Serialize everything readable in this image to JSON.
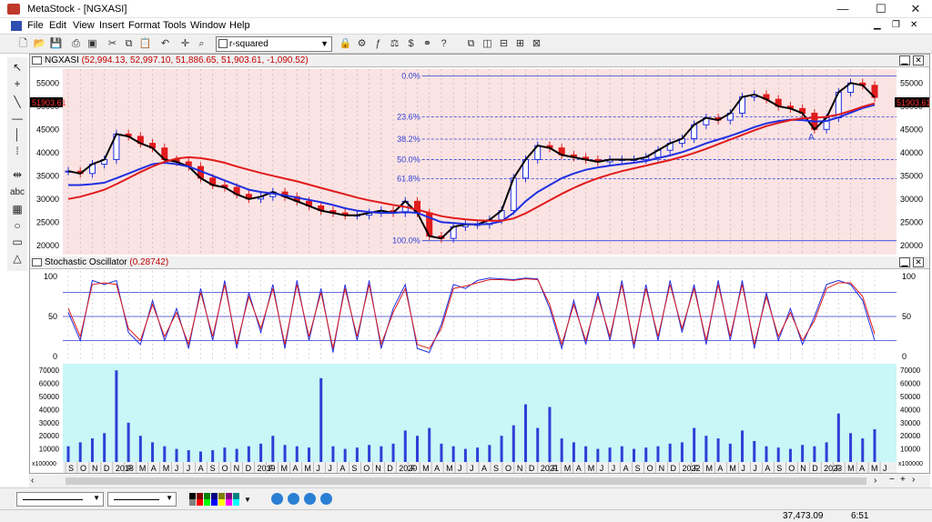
{
  "window": {
    "title": "MetaStock - [NGXASI]",
    "minimize": "—",
    "maximize": "☐",
    "close": "✕"
  },
  "menu": {
    "items": [
      "File",
      "Edit",
      "View",
      "Insert",
      "Format",
      "Tools",
      "Window",
      "Help"
    ]
  },
  "toolbar": {
    "indicator_value": "r-squared"
  },
  "price_pane": {
    "symbol": "NGXASI",
    "values": "(52,994.13, 52,997.10, 51,886.65, 51,903.61, -1,090.52)",
    "last_price_label_left": "51903.61",
    "last_price_label_right": "51903.61",
    "y_ticks": [
      "55000",
      "50000",
      "45000",
      "40000",
      "35000",
      "30000",
      "25000",
      "20000"
    ],
    "fib_labels": [
      "0.0%",
      "23.6%",
      "38.2%",
      "50.0%",
      "61.8%",
      "100.0%"
    ],
    "annotation": "A"
  },
  "stoch_pane": {
    "title": "Stochastic Oscillator",
    "value": "(0.28742)",
    "y_ticks": [
      "100",
      "50",
      "0"
    ]
  },
  "volume_pane": {
    "y_ticks": [
      "70000",
      "60000",
      "50000",
      "40000",
      "30000",
      "20000",
      "10000"
    ],
    "scale_label": "x100000"
  },
  "x_axis": {
    "labels": [
      "S",
      "O",
      "N",
      "D",
      "2018",
      "F",
      "M",
      "A",
      "M",
      "J",
      "J",
      "A",
      "S",
      "O",
      "N",
      "D",
      "2019",
      "F",
      "M",
      "A",
      "M",
      "J",
      "J",
      "A",
      "S",
      "O",
      "N",
      "D",
      "2020",
      "F",
      "M",
      "A",
      "M",
      "J",
      "J",
      "A",
      "S",
      "O",
      "N",
      "D",
      "2021",
      "F",
      "M",
      "A",
      "M",
      "J",
      "J",
      "A",
      "S",
      "O",
      "N",
      "D",
      "2022",
      "F",
      "M",
      "A",
      "M",
      "J",
      "J",
      "A",
      "S",
      "O",
      "N",
      "D",
      "2023",
      "F",
      "M",
      "A",
      "M",
      "J"
    ]
  },
  "status": {
    "value": "37,473.09",
    "time": "6:51"
  },
  "colors": {
    "price_bg": "#fbe3e3",
    "stoch_bg": "#ffffff",
    "volume_bg": "#c9f6f7",
    "ma_fast": "#000000",
    "ma_mid": "#1f2fe0",
    "ma_slow": "#e01b1b",
    "fib": "#2f3fd6"
  },
  "chart_data": [
    {
      "type": "line",
      "title": "NGXASI",
      "x": [
        "2017-09",
        "2017-10",
        "2017-11",
        "2017-12",
        "2018-01",
        "2018-02",
        "2018-03",
        "2018-04",
        "2018-05",
        "2018-06",
        "2018-07",
        "2018-08",
        "2018-09",
        "2018-10",
        "2018-11",
        "2018-12",
        "2019-01",
        "2019-02",
        "2019-03",
        "2019-04",
        "2019-05",
        "2019-06",
        "2019-07",
        "2019-08",
        "2019-09",
        "2019-10",
        "2019-11",
        "2019-12",
        "2020-01",
        "2020-02",
        "2020-03",
        "2020-04",
        "2020-05",
        "2020-06",
        "2020-07",
        "2020-08",
        "2020-09",
        "2020-10",
        "2020-11",
        "2020-12",
        "2021-01",
        "2021-02",
        "2021-03",
        "2021-04",
        "2021-05",
        "2021-06",
        "2021-07",
        "2021-08",
        "2021-09",
        "2021-10",
        "2021-11",
        "2021-12",
        "2022-01",
        "2022-02",
        "2022-03",
        "2022-04",
        "2022-05",
        "2022-06",
        "2022-07",
        "2022-08",
        "2022-09",
        "2022-10",
        "2022-11",
        "2022-12",
        "2023-01",
        "2023-02",
        "2023-03",
        "2023-04"
      ],
      "series": [
        {
          "values": [
            36000,
            35500,
            37500,
            38500,
            44000,
            43500,
            42000,
            41000,
            38500,
            38000,
            37000,
            34500,
            33000,
            32500,
            31000,
            30000,
            30500,
            31500,
            30500,
            29500,
            28500,
            27500,
            27000,
            26500,
            26500,
            27000,
            27500,
            27000,
            29500,
            27000,
            22000,
            21500,
            24000,
            24500,
            24500,
            25500,
            27500,
            34500,
            38500,
            41500,
            41000,
            39500,
            39000,
            38500,
            38000,
            38500,
            38500,
            38500,
            39000,
            40500,
            42000,
            43000,
            46000,
            47500,
            47000,
            48500,
            52000,
            52500,
            51500,
            50000,
            49500,
            48500,
            45000,
            47500,
            53000,
            55000,
            54500,
            51900
          ]
        },
        {
          "values": [
            33000,
            33000,
            33200,
            33500,
            34500,
            35500,
            36500,
            37500,
            37800,
            37500,
            37000,
            36000,
            35000,
            34000,
            33000,
            32000,
            31500,
            31200,
            30800,
            30300,
            29800,
            29300,
            28700,
            28000,
            27500,
            27200,
            27000,
            27000,
            27200,
            27000,
            26000,
            25000,
            24800,
            24600,
            24500,
            24600,
            25200,
            27000,
            29500,
            31500,
            33000,
            34500,
            35500,
            36300,
            36800,
            37200,
            37500,
            37800,
            38200,
            38800,
            39400,
            40100,
            41000,
            42000,
            42800,
            43600,
            44500,
            45500,
            46300,
            46800,
            47100,
            47000,
            46700,
            46800,
            47600,
            48600,
            49600,
            50300
          ]
        },
        {
          "values": [
            30000,
            30500,
            31200,
            32000,
            33200,
            34500,
            35800,
            37000,
            38000,
            38700,
            39000,
            38800,
            38400,
            37800,
            37000,
            36300,
            35600,
            35000,
            34400,
            33800,
            33100,
            32400,
            31700,
            31000,
            30300,
            29700,
            29200,
            28700,
            28300,
            27700,
            27000,
            26300,
            25900,
            25600,
            25400,
            25300,
            25300,
            25800,
            26900,
            28300,
            29700,
            31100,
            32400,
            33500,
            34500,
            35300,
            36000,
            36600,
            37200,
            37800,
            38400,
            39100,
            39900,
            40800,
            41800,
            42800,
            43800,
            44800,
            45700,
            46400,
            47000,
            47400,
            47500,
            47700,
            48200,
            49000,
            49900,
            50600
          ]
        }
      ],
      "ylim": [
        18000,
        58000
      ],
      "fib_levels": [
        {
          "label": "0.0%",
          "value": 56500
        },
        {
          "label": "23.6%",
          "value": 47700
        },
        {
          "label": "38.2%",
          "value": 42900
        },
        {
          "label": "50.0%",
          "value": 38500
        },
        {
          "label": "61.8%",
          "value": 34400
        },
        {
          "label": "100.0%",
          "value": 21000
        }
      ]
    },
    {
      "type": "line",
      "title": "Stochastic Oscillator",
      "x": [
        "2017-09",
        "2017-10",
        "2017-11",
        "2017-12",
        "2018-01",
        "2018-02",
        "2018-03",
        "2018-04",
        "2018-05",
        "2018-06",
        "2018-07",
        "2018-08",
        "2018-09",
        "2018-10",
        "2018-11",
        "2018-12",
        "2019-01",
        "2019-02",
        "2019-03",
        "2019-04",
        "2019-05",
        "2019-06",
        "2019-07",
        "2019-08",
        "2019-09",
        "2019-10",
        "2019-11",
        "2019-12",
        "2020-01",
        "2020-02",
        "2020-03",
        "2020-04",
        "2020-05",
        "2020-06",
        "2020-07",
        "2020-08",
        "2020-09",
        "2020-10",
        "2020-11",
        "2020-12",
        "2021-01",
        "2021-02",
        "2021-03",
        "2021-04",
        "2021-05",
        "2021-06",
        "2021-07",
        "2021-08",
        "2021-09",
        "2021-10",
        "2021-11",
        "2021-12",
        "2022-01",
        "2022-02",
        "2022-03",
        "2022-04",
        "2022-05",
        "2022-06",
        "2022-07",
        "2022-08",
        "2022-09",
        "2022-10",
        "2022-11",
        "2022-12",
        "2023-01",
        "2023-02",
        "2023-03",
        "2023-04"
      ],
      "series": [
        {
          "values": [
            55,
            20,
            95,
            90,
            95,
            30,
            15,
            70,
            20,
            60,
            10,
            85,
            20,
            95,
            10,
            80,
            30,
            90,
            10,
            95,
            20,
            85,
            5,
            90,
            20,
            95,
            10,
            60,
            90,
            10,
            5,
            40,
            90,
            85,
            95,
            98,
            97,
            96,
            98,
            97,
            60,
            10,
            70,
            15,
            80,
            20,
            95,
            10,
            90,
            20,
            95,
            30,
            90,
            15,
            95,
            20,
            95,
            10,
            80,
            20,
            60,
            15,
            50,
            90,
            95,
            90,
            70,
            20
          ]
        },
        {
          "values": [
            60,
            25,
            90,
            92,
            90,
            35,
            20,
            65,
            25,
            55,
            15,
            80,
            25,
            90,
            15,
            75,
            35,
            85,
            15,
            90,
            25,
            80,
            10,
            85,
            25,
            90,
            15,
            55,
            85,
            15,
            10,
            35,
            85,
            88,
            92,
            96,
            96,
            95,
            97,
            96,
            65,
            15,
            65,
            20,
            75,
            25,
            90,
            15,
            85,
            25,
            90,
            35,
            85,
            20,
            90,
            25,
            90,
            15,
            75,
            25,
            55,
            20,
            45,
            85,
            92,
            92,
            75,
            28
          ]
        }
      ],
      "ylim": [
        0,
        100
      ]
    },
    {
      "type": "bar",
      "title": "Volume",
      "x": [
        "2017-09",
        "2017-10",
        "2017-11",
        "2017-12",
        "2018-01",
        "2018-02",
        "2018-03",
        "2018-04",
        "2018-05",
        "2018-06",
        "2018-07",
        "2018-08",
        "2018-09",
        "2018-10",
        "2018-11",
        "2018-12",
        "2019-01",
        "2019-02",
        "2019-03",
        "2019-04",
        "2019-05",
        "2019-06",
        "2019-07",
        "2019-08",
        "2019-09",
        "2019-10",
        "2019-11",
        "2019-12",
        "2020-01",
        "2020-02",
        "2020-03",
        "2020-04",
        "2020-05",
        "2020-06",
        "2020-07",
        "2020-08",
        "2020-09",
        "2020-10",
        "2020-11",
        "2020-12",
        "2021-01",
        "2021-02",
        "2021-03",
        "2021-04",
        "2021-05",
        "2021-06",
        "2021-07",
        "2021-08",
        "2021-09",
        "2021-10",
        "2021-11",
        "2021-12",
        "2022-01",
        "2022-02",
        "2022-03",
        "2022-04",
        "2022-05",
        "2022-06",
        "2022-07",
        "2022-08",
        "2022-09",
        "2022-10",
        "2022-11",
        "2022-12",
        "2023-01",
        "2023-02",
        "2023-03",
        "2023-04"
      ],
      "values": [
        12000,
        15000,
        18000,
        22000,
        70000,
        30000,
        20000,
        15000,
        12000,
        10000,
        9000,
        8000,
        9000,
        11000,
        10000,
        12000,
        14000,
        20000,
        13000,
        12000,
        11000,
        64000,
        12000,
        10000,
        11000,
        13000,
        12000,
        14000,
        24000,
        20000,
        26000,
        14000,
        12000,
        10000,
        11000,
        13000,
        20000,
        28000,
        44000,
        26000,
        42000,
        18000,
        15000,
        12000,
        10000,
        11000,
        12000,
        10000,
        11000,
        12000,
        14000,
        15000,
        26000,
        20000,
        18000,
        14000,
        24000,
        16000,
        12000,
        11000,
        10000,
        13000,
        12000,
        15000,
        37000,
        22000,
        18000,
        25000
      ],
      "ylim": [
        0,
        75000
      ]
    }
  ]
}
